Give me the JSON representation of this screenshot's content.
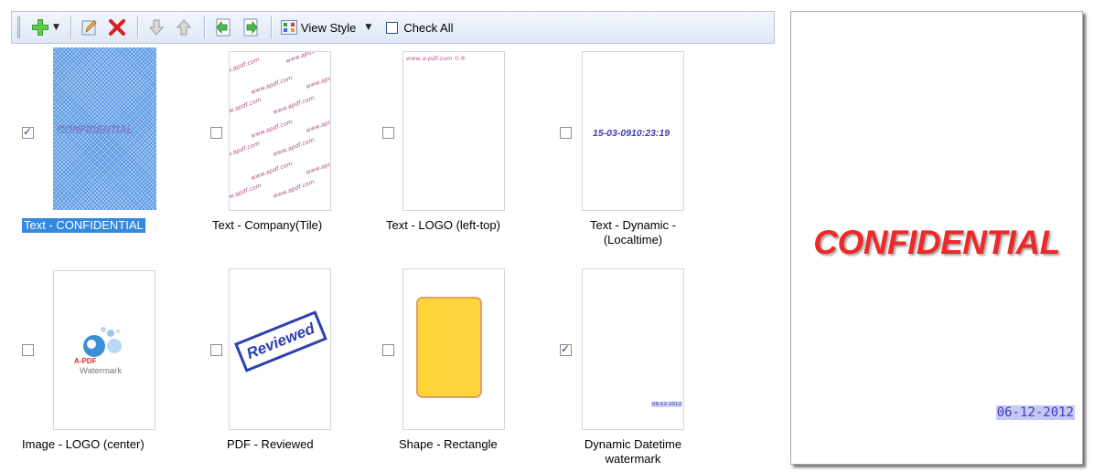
{
  "toolbar": {
    "add_icon": "plus-icon",
    "edit_icon": "pencil-icon",
    "delete_icon": "red-x-icon",
    "move_down_icon": "arrow-down-icon",
    "move_up_icon": "arrow-up-icon",
    "import_icon": "import-icon",
    "export_icon": "export-icon",
    "view_style_label": "View Style",
    "check_all_label": "Check All"
  },
  "watermarks": [
    {
      "caption": "Text - CONFIDENTIAL",
      "checked": true,
      "selected": true,
      "preview_text": "CONFIDENTIAL"
    },
    {
      "caption": "Text - Company(Tile)",
      "checked": false,
      "tile_text": "www.apdf.com"
    },
    {
      "caption": "Text - LOGO (left-top)",
      "checked": false,
      "preview_text": "www.a-pdf.com ©®"
    },
    {
      "caption_line1": "Text - Dynamic -",
      "caption_line2": "(Localtime)",
      "checked": false,
      "preview_text": "15-03-0910:23:19"
    },
    {
      "caption": "Image - LOGO (center)",
      "checked": false,
      "logo_line1": "A-PDF",
      "logo_line2": "Watermark"
    },
    {
      "caption": "PDF - Reviewed",
      "checked": false,
      "preview_text": "Reviewed"
    },
    {
      "caption": "Shape - Rectangle",
      "checked": false
    },
    {
      "caption_line1": "Dynamic Datetime",
      "caption_line2": "watermark",
      "checked": true,
      "preview_text": "06-12-2012"
    }
  ],
  "preview": {
    "main_text": "CONFIDENTIAL",
    "date_text": "06-12-2012"
  },
  "colors": {
    "confidential_red": "#ec2a2a",
    "selection_blue": "#3388e0",
    "dynamic_blue": "#3d3db8"
  }
}
